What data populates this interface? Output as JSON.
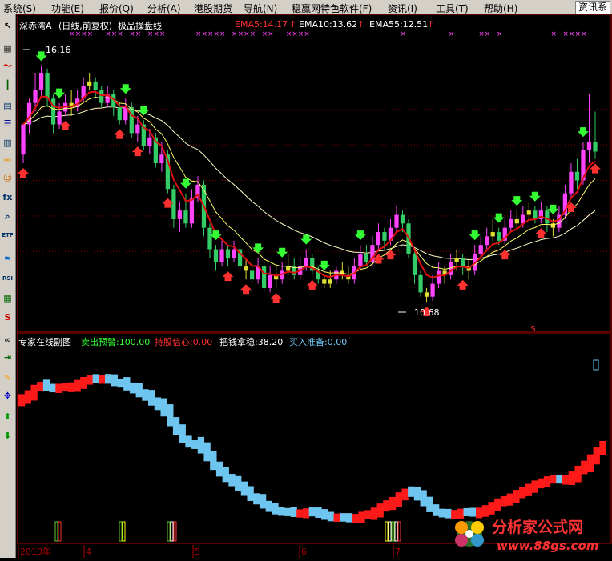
{
  "menu": {
    "items": [
      "系统(S)",
      "功能(E)",
      "报价(Q)",
      "分析(A)",
      "港股期货",
      "导航(N)",
      "稳赢网特色软件(F)",
      "资讯(I)",
      "工具(T)",
      "帮助(H)"
    ],
    "search_label": "资讯系"
  },
  "toolbar": {
    "buttons": [
      {
        "icon": "cursor-icon"
      },
      {
        "icon": "grid-icon"
      },
      {
        "icon": "line-chart-icon"
      },
      {
        "icon": "candle-icon"
      },
      {
        "icon": "news-icon"
      },
      {
        "icon": "list-icon"
      },
      {
        "icon": "table-icon"
      },
      {
        "icon": "mail-icon"
      },
      {
        "icon": "people-icon"
      },
      {
        "icon": "fx-icon"
      },
      {
        "icon": "search-icon"
      },
      {
        "icon": "etf-icon"
      },
      {
        "icon": "wave-icon"
      },
      {
        "icon": "rsi-icon"
      },
      {
        "icon": "sheet-icon"
      },
      {
        "icon": "dollar-icon"
      },
      {
        "icon": "link-icon"
      },
      {
        "icon": "exit-icon"
      },
      {
        "icon": "pen-icon"
      },
      {
        "icon": "move-icon"
      },
      {
        "icon": "arrow-up-icon"
      },
      {
        "icon": "arrow-down-icon"
      }
    ],
    "labels": {
      "fx": "fx",
      "etf": "ETF",
      "rsi": "RSI",
      "dollar": "S"
    }
  },
  "main_chart": {
    "stock": "深赤湾A",
    "period": "(日线,前复权)",
    "indicator": "极品操盘线",
    "ema5": "EMA5:14.17",
    "ema10": "EMA10:13.62",
    "ema55": "EMA55:12.51",
    "high_label": "16.16",
    "low_label": "10.68",
    "dollar_mark": "$",
    "colors": {
      "up": "#ff44ff",
      "down": "#33cc66",
      "neutral": "#dddd33",
      "ema5": "#e01010",
      "ema10": "#ffff66",
      "ema55": "#ffffcc",
      "buy_arrow": "#ff3030",
      "sell_arrow": "#33ff33"
    }
  },
  "sub_chart": {
    "title": "专家在线副图",
    "sell_warning": "卖出预警:100.00",
    "hold_confidence": "持股信心:0.00",
    "hold_steady": "把钱拿稳:38.20",
    "buy_prepare": "买入准备:0.00",
    "colors": {
      "red_band": "#ff1a1a",
      "blue_band": "#6ec6f0",
      "green_bar": "#66cc33",
      "red_bar": "#ff3333",
      "white_bar": "#ffffff",
      "yellow_bar": "#ffff00"
    }
  },
  "time_axis": {
    "labels": [
      "2010年",
      "4",
      "5",
      "6",
      "7"
    ]
  },
  "watermark": {
    "brand": "分析家公式网",
    "url": "www.88gs.com"
  },
  "chart_data": {
    "type": "candlestick",
    "title": "极品操盘线",
    "ylim": [
      10.2,
      16.8
    ],
    "candles": [
      [
        14.1,
        14.8,
        14.5,
        13.9
      ],
      [
        14.8,
        15.3,
        15.4,
        14.6
      ],
      [
        15.3,
        15.6,
        16.0,
        15.1
      ],
      [
        15.6,
        16.0,
        16.16,
        15.4
      ],
      [
        16.0,
        15.4,
        16.1,
        15.2
      ],
      [
        15.4,
        14.8,
        15.5,
        14.6
      ],
      [
        14.8,
        15.1,
        15.3,
        14.7
      ],
      [
        15.1,
        15.3,
        15.5,
        15.0
      ],
      [
        15.3,
        15.2,
        15.6,
        15.0
      ],
      [
        15.2,
        15.4,
        15.6,
        15.1
      ],
      [
        15.4,
        15.7,
        15.9,
        15.3
      ],
      [
        15.7,
        15.8,
        16.0,
        15.6
      ],
      [
        15.8,
        15.6,
        15.9,
        15.4
      ],
      [
        15.6,
        15.3,
        15.7,
        15.2
      ],
      [
        15.3,
        15.5,
        15.7,
        15.2
      ],
      [
        15.5,
        15.2,
        15.6,
        15.0
      ],
      [
        15.2,
        14.9,
        15.3,
        14.8
      ],
      [
        14.9,
        15.2,
        15.4,
        14.8
      ],
      [
        15.2,
        14.6,
        15.3,
        14.5
      ],
      [
        14.6,
        14.8,
        15.0,
        14.4
      ],
      [
        14.8,
        14.3,
        14.9,
        14.2
      ],
      [
        14.3,
        14.5,
        14.7,
        14.1
      ],
      [
        14.5,
        13.9,
        14.6,
        13.8
      ],
      [
        13.9,
        14.1,
        14.4,
        13.7
      ],
      [
        14.1,
        13.3,
        14.2,
        13.2
      ],
      [
        13.3,
        12.6,
        13.4,
        12.4
      ],
      [
        12.6,
        12.8,
        13.0,
        12.3
      ],
      [
        12.8,
        12.5,
        13.2,
        12.4
      ],
      [
        12.5,
        13.1,
        13.3,
        12.4
      ],
      [
        13.1,
        13.4,
        13.6,
        13.0
      ],
      [
        13.4,
        12.4,
        13.5,
        12.2
      ],
      [
        12.4,
        11.9,
        12.5,
        11.7
      ],
      [
        11.9,
        11.6,
        12.0,
        11.4
      ],
      [
        11.6,
        11.9,
        12.1,
        11.5
      ],
      [
        11.9,
        11.7,
        12.0,
        11.5
      ],
      [
        11.7,
        11.9,
        12.1,
        11.6
      ],
      [
        11.9,
        11.5,
        12.0,
        11.4
      ],
      [
        11.5,
        11.4,
        11.7,
        11.2
      ],
      [
        11.4,
        11.2,
        11.6,
        11.1
      ],
      [
        11.2,
        11.5,
        11.7,
        11.1
      ],
      [
        11.5,
        11.0,
        11.6,
        10.9
      ],
      [
        11.0,
        11.3,
        11.5,
        10.9
      ],
      [
        11.3,
        11.2,
        11.5,
        11.0
      ],
      [
        11.2,
        11.4,
        11.6,
        11.1
      ],
      [
        11.4,
        11.5,
        11.8,
        11.3
      ],
      [
        11.5,
        11.3,
        11.7,
        11.2
      ],
      [
        11.3,
        11.5,
        11.7,
        11.2
      ],
      [
        11.5,
        11.7,
        11.9,
        11.4
      ],
      [
        11.7,
        11.4,
        11.8,
        11.3
      ],
      [
        11.4,
        11.2,
        11.5,
        11.1
      ],
      [
        11.2,
        11.1,
        11.3,
        11.0
      ],
      [
        11.1,
        11.2,
        11.4,
        11.0
      ],
      [
        11.2,
        11.4,
        11.5,
        11.1
      ],
      [
        11.4,
        11.3,
        11.6,
        11.2
      ],
      [
        11.3,
        11.2,
        11.5,
        11.1
      ],
      [
        11.2,
        11.5,
        11.7,
        11.1
      ],
      [
        11.5,
        11.8,
        12.0,
        11.4
      ],
      [
        11.8,
        11.6,
        12.0,
        11.5
      ],
      [
        11.6,
        12.0,
        12.2,
        11.5
      ],
      [
        12.0,
        12.3,
        12.5,
        11.9
      ],
      [
        12.3,
        12.1,
        12.4,
        11.9
      ],
      [
        12.1,
        12.4,
        12.6,
        12.0
      ],
      [
        12.4,
        12.7,
        12.9,
        12.3
      ],
      [
        12.7,
        12.5,
        12.8,
        12.3
      ],
      [
        12.5,
        11.8,
        12.6,
        11.7
      ],
      [
        11.8,
        11.3,
        11.9,
        11.1
      ],
      [
        11.3,
        10.9,
        11.4,
        10.8
      ],
      [
        10.9,
        10.8,
        11.0,
        10.68
      ],
      [
        10.8,
        11.1,
        11.3,
        10.7
      ],
      [
        11.1,
        11.4,
        11.6,
        11.0
      ],
      [
        11.4,
        11.3,
        11.5,
        11.1
      ],
      [
        11.3,
        11.6,
        11.8,
        11.2
      ],
      [
        11.6,
        11.7,
        11.9,
        11.4
      ],
      [
        11.7,
        11.5,
        11.8,
        11.3
      ],
      [
        11.5,
        11.4,
        11.7,
        11.2
      ],
      [
        11.4,
        11.8,
        12.0,
        11.3
      ],
      [
        11.8,
        12.0,
        12.2,
        11.7
      ],
      [
        12.0,
        12.2,
        12.4,
        11.9
      ],
      [
        12.2,
        12.3,
        12.6,
        12.1
      ],
      [
        12.3,
        12.1,
        12.4,
        12.0
      ],
      [
        12.1,
        12.4,
        12.6,
        12.0
      ],
      [
        12.4,
        12.6,
        12.8,
        12.3
      ],
      [
        12.6,
        12.5,
        12.8,
        12.4
      ],
      [
        12.5,
        12.7,
        12.9,
        12.4
      ],
      [
        12.7,
        12.8,
        13.0,
        12.6
      ],
      [
        12.8,
        12.6,
        12.9,
        12.5
      ],
      [
        12.6,
        12.8,
        13.0,
        12.5
      ],
      [
        12.8,
        12.5,
        12.9,
        12.3
      ],
      [
        12.5,
        12.4,
        12.6,
        12.2
      ],
      [
        12.4,
        12.7,
        12.9,
        12.3
      ],
      [
        12.7,
        13.2,
        13.4,
        12.6
      ],
      [
        13.2,
        13.7,
        13.9,
        13.1
      ],
      [
        13.7,
        13.5,
        14.0,
        13.3
      ],
      [
        13.5,
        14.2,
        14.4,
        13.4
      ],
      [
        14.2,
        14.4,
        15.5,
        13.9
      ],
      [
        14.4,
        14.17,
        15.1,
        14.0
      ]
    ]
  }
}
